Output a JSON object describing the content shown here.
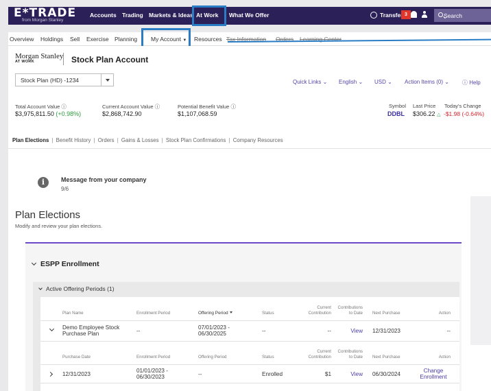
{
  "topnav": {
    "logo": "E*TRADE",
    "logo_sub": "from Morgan Stanley",
    "items": [
      "Accounts",
      "Trading",
      "Markets & Ideas",
      "At Work",
      "What We Offer"
    ],
    "transfer": "Transfer",
    "badge_count": "3",
    "search_placeholder": "Search"
  },
  "subnav": {
    "items": [
      "Overview",
      "Holdings",
      "Sell",
      "Exercise",
      "Planning",
      "My Account",
      "Resources",
      "Tax Information",
      "Orders",
      "Learning Center"
    ]
  },
  "header": {
    "brand": "Morgan Stanley",
    "brand_sub": "AT WORK",
    "title": "Stock Plan Account",
    "account_select": "Stock Plan (HD) -1234",
    "quick_links": [
      "Quick Links",
      "English",
      "USD",
      "Action Items (0)",
      "Help"
    ]
  },
  "summary": {
    "total_label": "Total Account Value",
    "total_value": "$3,975,811.50",
    "total_change": "(+0.98%)",
    "current_label": "Current Account Value",
    "current_value": "$2,868,742.90",
    "potential_label": "Potential Benefit Value",
    "potential_value": "$1,107,068.59",
    "symbol_label": "Symbol",
    "symbol": "DDBL",
    "last_price_label": "Last Price",
    "last_price": "$306.22",
    "todays_change_label": "Today's Change",
    "todays_change": "-$1.98 (-0.64%)"
  },
  "tabs": [
    "Plan Elections",
    "Benefit History",
    "Orders",
    "Gains & Losses",
    "Stock Plan Confirmations",
    "Company Resources"
  ],
  "message": {
    "title": "Message from your company",
    "date": "9/6"
  },
  "plan_elections": {
    "title": "Plan Elections",
    "subtitle": "Modify and review your plan elections."
  },
  "espp": {
    "title": "ESPP Enrollment",
    "active_periods": "Active Offering Periods (1)",
    "offering_header": {
      "plan_name": "Plan Name",
      "enrollment_period": "Enrollment Period",
      "offering_period": "Offering Period",
      "status": "Status",
      "current_contribution_1": "Current",
      "current_contribution_2": "Contribution",
      "contributions_1": "Contributions",
      "contributions_2": "to Date",
      "next_purchase": "Next Purchase",
      "action": "Action"
    },
    "offering_row": {
      "plan_name_1": "Demo Employee Stock",
      "plan_name_2": "Purchase Plan",
      "enrollment_period": "--",
      "offering_period_1": "07/01/2023 -",
      "offering_period_2": "06/30/2025",
      "status": "--",
      "current_contribution": "--",
      "contributions": "View",
      "next_purchase": "12/31/2023",
      "action": "--"
    },
    "purchase_header": {
      "purchase_date": "Purchase Date",
      "enrollment_period": "Enrollment Period",
      "offering_period": "Offering Period",
      "status": "Status",
      "current_contribution_1": "Current",
      "current_contribution_2": "Contribution",
      "contributions_1": "Contributions",
      "contributions_2": "to Date",
      "next_purchase": "Next Purchase",
      "action": "Action"
    },
    "purchase_row": {
      "purchase_date": "12/31/2023",
      "enrollment_period_1": "01/01/2023 -",
      "enrollment_period_2": "06/30/2023",
      "offering_period": "--",
      "status": "Enrolled",
      "current_contribution": "$1",
      "contributions": "View",
      "next_purchase": "06/30/2024",
      "action_1": "Change",
      "action_2": "Enrollment"
    }
  },
  "colors": {
    "nav_bg": "#2c2059",
    "highlight": "#2a7dc5",
    "accent_purple": "#6b48c8",
    "positive": "#2e9a3d",
    "negative": "#d2242b",
    "link": "#4a3ba8"
  }
}
